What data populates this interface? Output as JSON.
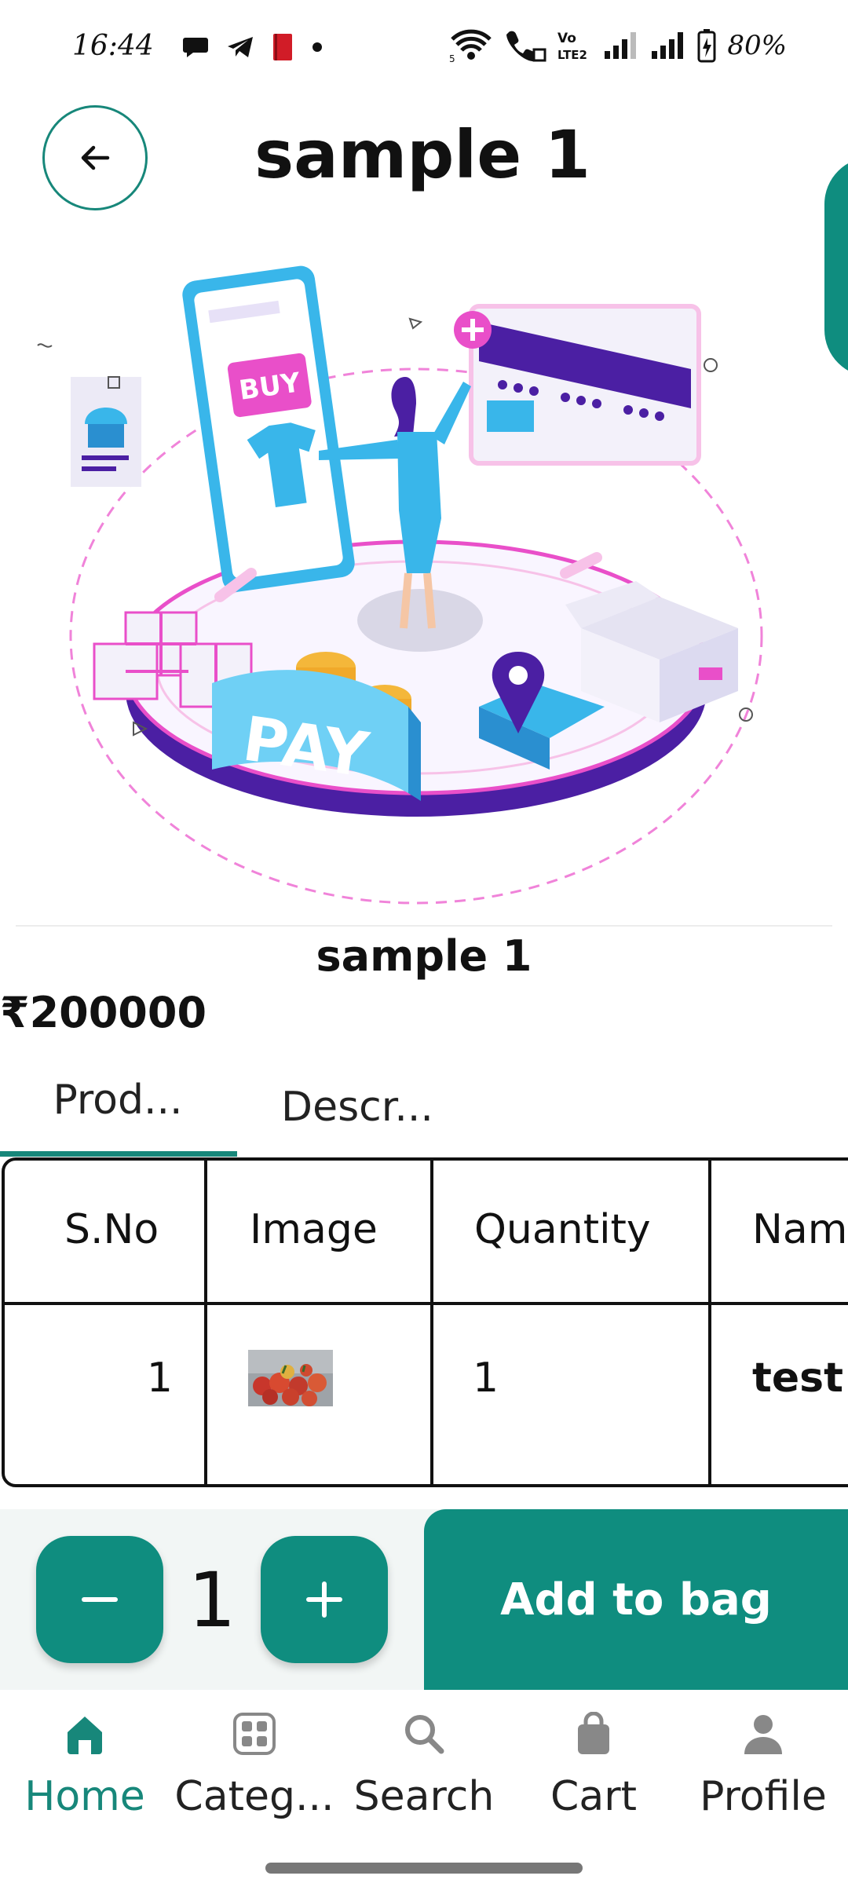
{
  "status_bar": {
    "time": "16:44",
    "battery": "80%",
    "left_icons": [
      "chat-icon",
      "telegram-icon",
      "book-icon",
      "dot-icon"
    ],
    "right_icons": [
      "wifi-icon",
      "wifi-calling-icon",
      "volte-icon",
      "signal-icon",
      "signal-icon",
      "battery-icon"
    ]
  },
  "header": {
    "title": "sample 1",
    "back_icon": "arrow-left-icon"
  },
  "product": {
    "name": "sample 1",
    "price": "₹200000"
  },
  "tabs": [
    {
      "label": "Prod...",
      "active": true
    },
    {
      "label": "Descr...",
      "active": false
    }
  ],
  "table": {
    "headers": [
      "S.No",
      "Image",
      "Quantity",
      "Nam"
    ],
    "rows": [
      {
        "sno": "1",
        "image": "apples-thumbnail",
        "quantity": "1",
        "name": "test"
      }
    ]
  },
  "actions": {
    "quantity": "1",
    "minus_icon": "minus-icon",
    "plus_icon": "plus-icon",
    "add_to_bag": "Add to bag"
  },
  "bottom_nav": [
    {
      "label": "Home",
      "icon": "home-icon",
      "active": true
    },
    {
      "label": "Categ...",
      "icon": "grid-icon",
      "active": false
    },
    {
      "label": "Search",
      "icon": "search-icon",
      "active": false
    },
    {
      "label": "Cart",
      "icon": "bag-icon",
      "active": false
    },
    {
      "label": "Profile",
      "icon": "user-icon",
      "active": false
    }
  ],
  "colors": {
    "accent": "#0f8d7f",
    "hero_purple": "#4b1fa3",
    "hero_pink": "#e94fc9",
    "hero_blue": "#39b6ea"
  },
  "hero_text": {
    "buy": "BUY",
    "pay": "PAY"
  }
}
